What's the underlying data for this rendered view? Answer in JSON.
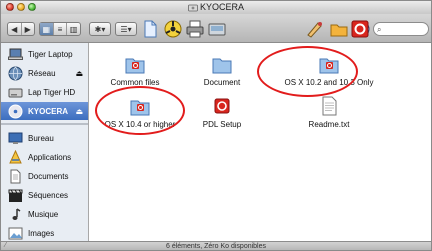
{
  "window": {
    "title": "KYOCERA"
  },
  "toolbar": {
    "nav": [
      "◀",
      "▶"
    ],
    "views": [
      "▦",
      "≡",
      "▥"
    ],
    "action_label": "✱▾",
    "arrange_label": "☰▾",
    "search_placeholder": ""
  },
  "sidebar": {
    "devices": [
      {
        "label": "Tiger Laptop",
        "eject": ""
      },
      {
        "label": "Réseau",
        "eject": "⏏"
      },
      {
        "label": "Lap Tiger HD",
        "eject": ""
      },
      {
        "label": "KYOCERA",
        "eject": "⏏"
      }
    ],
    "places": [
      {
        "label": "Bureau"
      },
      {
        "label": "Applications"
      },
      {
        "label": "Documents"
      },
      {
        "label": "Séquences"
      },
      {
        "label": "Musique"
      },
      {
        "label": "Images"
      }
    ]
  },
  "files": [
    {
      "label": "Common files"
    },
    {
      "label": "Document"
    },
    {
      "label": "OS X 10.2 and 10.3 Only"
    },
    {
      "label": "OS X 10.4 or higher"
    },
    {
      "label": "PDL Setup"
    },
    {
      "label": "Readme.txt"
    }
  ],
  "status": {
    "text": "6 éléments, Zéro Ko disponibles"
  },
  "colors": {
    "accent": "#3d6ebf",
    "annotation": "#e21c1c",
    "sidebar_bg": "#e8edf3"
  }
}
